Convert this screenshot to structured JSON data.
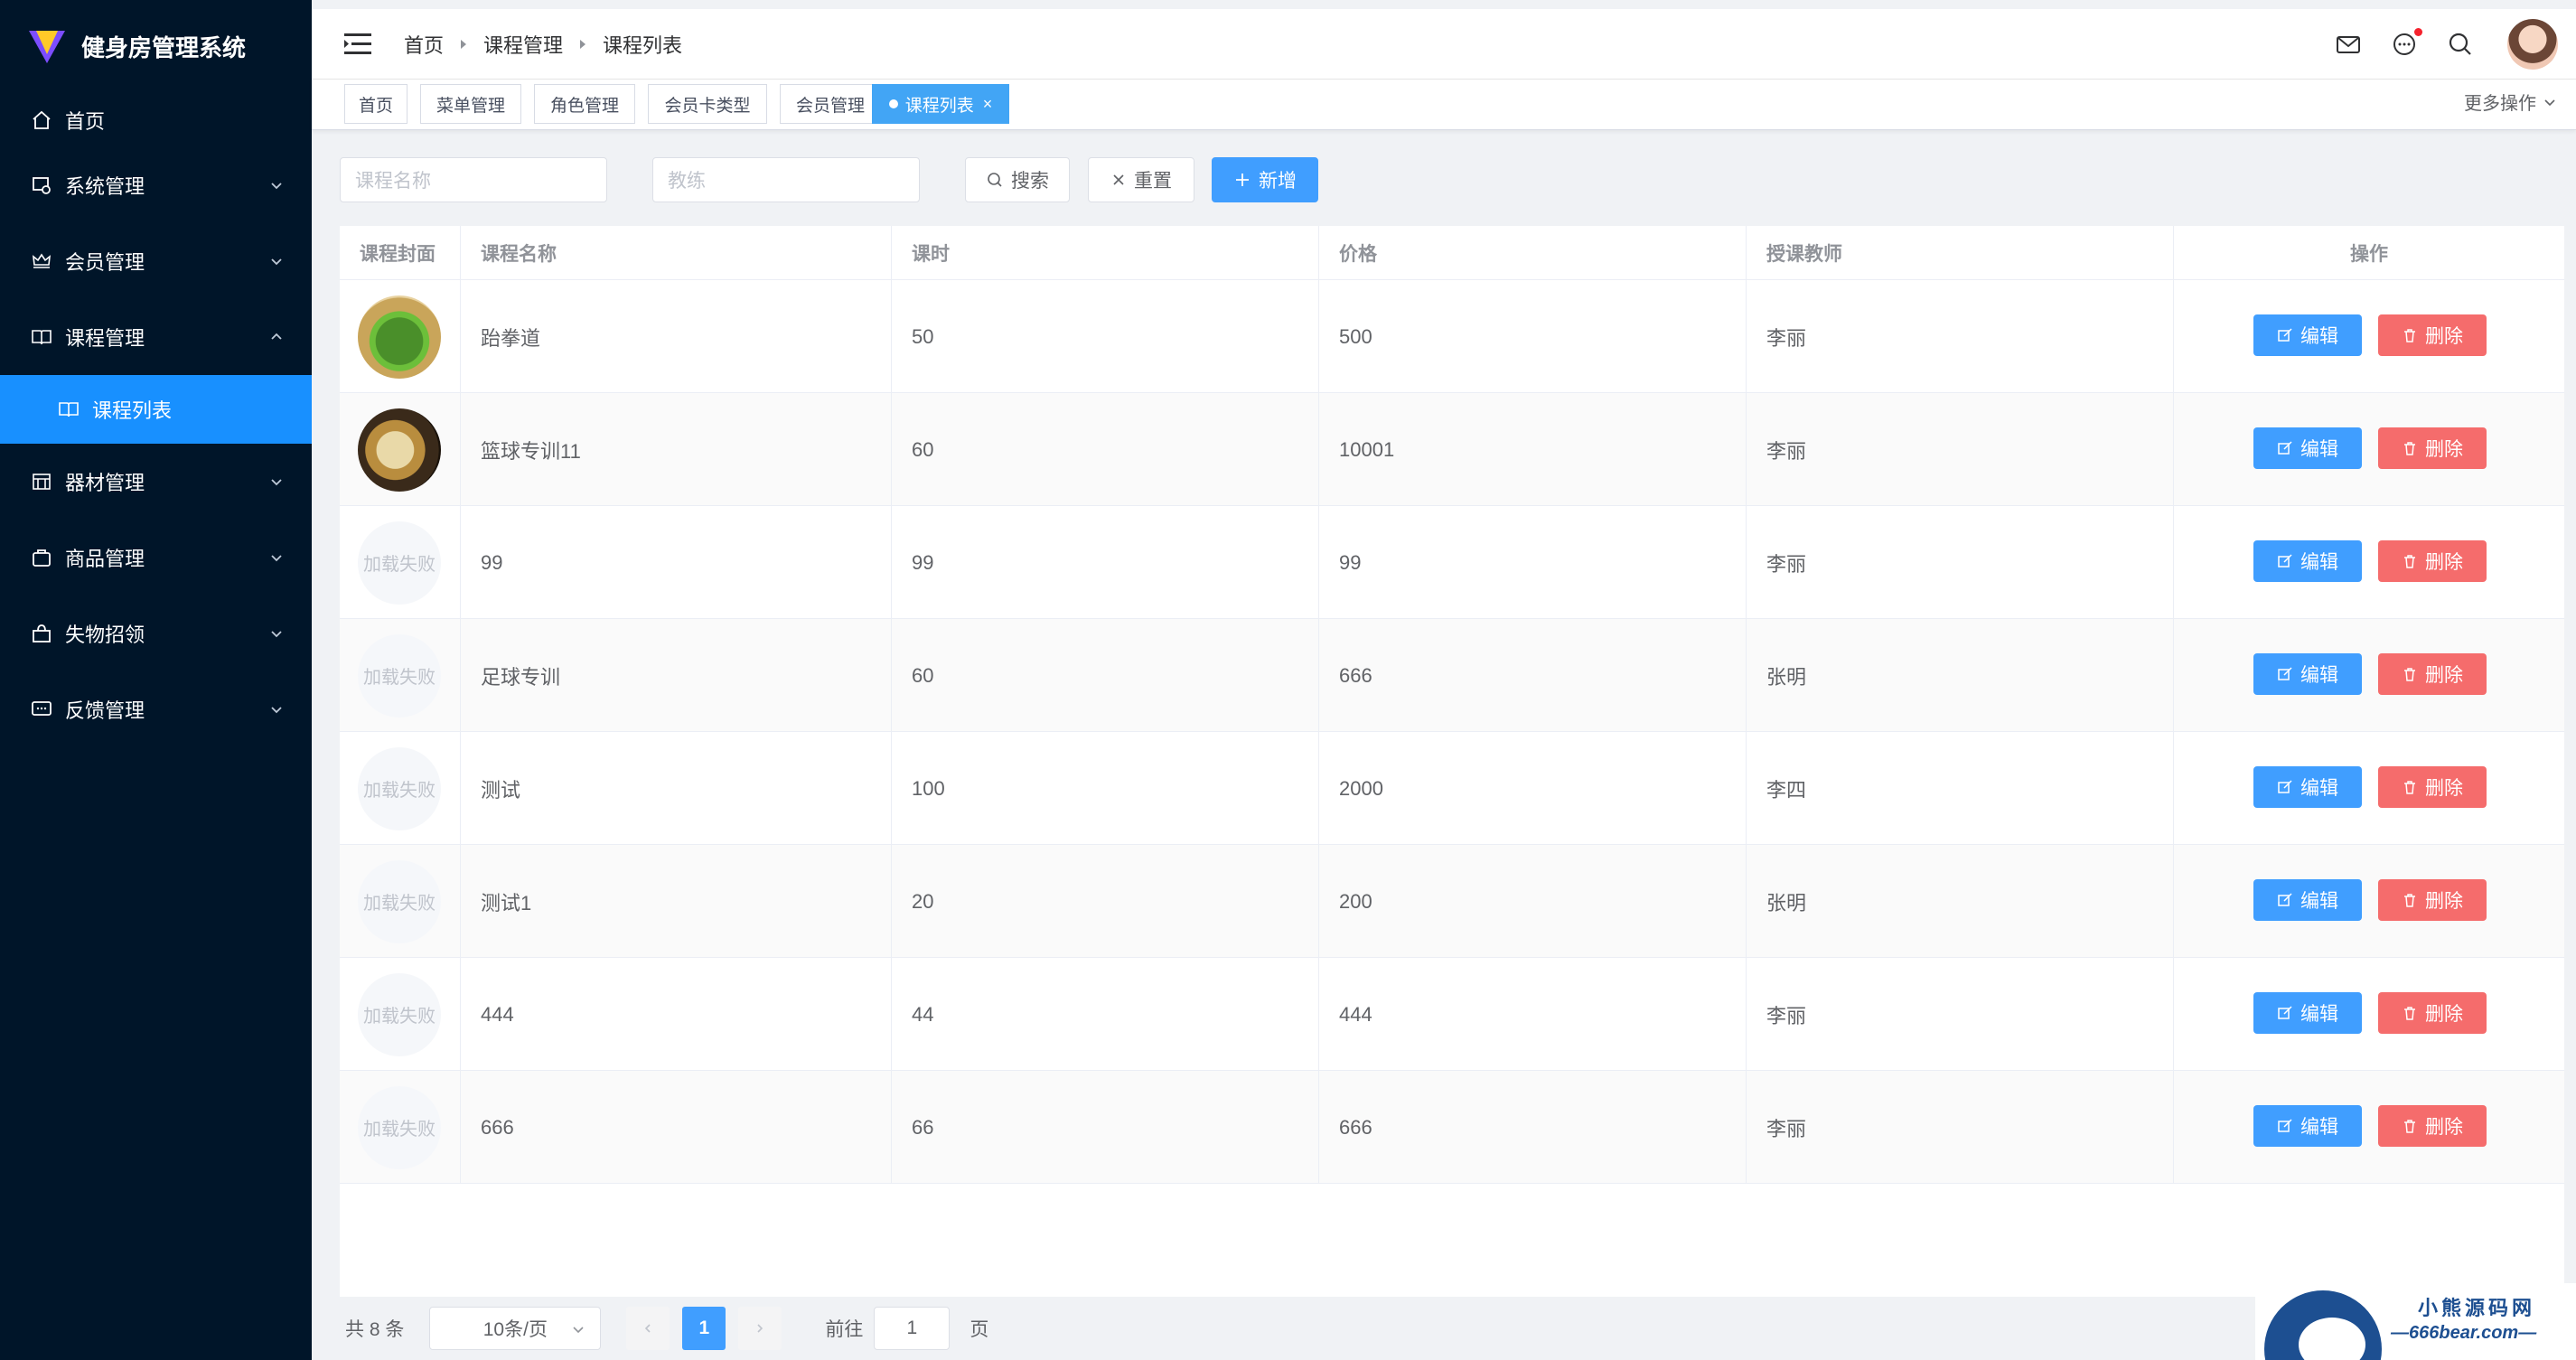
{
  "app": {
    "title": "健身房管理系统"
  },
  "sidebar": {
    "items": [
      {
        "label": "首页",
        "icon": "home-icon"
      },
      {
        "label": "系统管理",
        "icon": "system-icon"
      },
      {
        "label": "会员管理",
        "icon": "crown-icon"
      },
      {
        "label": "课程管理",
        "icon": "book-icon"
      },
      {
        "label": "课程列表",
        "icon": "reading-icon"
      },
      {
        "label": "器材管理",
        "icon": "equipment-icon"
      },
      {
        "label": "商品管理",
        "icon": "goods-icon"
      },
      {
        "label": "失物招领",
        "icon": "bag-icon"
      },
      {
        "label": "反馈管理",
        "icon": "chat-icon"
      }
    ]
  },
  "breadcrumb": [
    "首页",
    "课程管理",
    "课程列表"
  ],
  "tags": [
    "首页",
    "菜单管理",
    "角色管理",
    "会员卡类型",
    "会员管理",
    "课程列表"
  ],
  "more_ops": "更多操作",
  "filters": {
    "course_name_placeholder": "课程名称",
    "coach_placeholder": "教练",
    "search_label": "搜索",
    "reset_label": "重置",
    "add_label": "新增"
  },
  "table": {
    "columns": [
      "课程封面",
      "课程名称",
      "课时",
      "价格",
      "授课教师",
      "操作"
    ],
    "edit_label": "编辑",
    "delete_label": "删除",
    "load_failed": "加载失败",
    "rows": [
      {
        "name": "跆拳道",
        "hours": "50",
        "price": "500",
        "teacher": "李丽"
      },
      {
        "name": "篮球专训11",
        "hours": "60",
        "price": "10001",
        "teacher": "李丽"
      },
      {
        "name": "99",
        "hours": "99",
        "price": "99",
        "teacher": "李丽"
      },
      {
        "name": "足球专训",
        "hours": "60",
        "price": "666",
        "teacher": "张明"
      },
      {
        "name": "测试",
        "hours": "100",
        "price": "2000",
        "teacher": "李四"
      },
      {
        "name": "测试1",
        "hours": "20",
        "price": "200",
        "teacher": "张明"
      },
      {
        "name": "444",
        "hours": "44",
        "price": "444",
        "teacher": "李丽"
      },
      {
        "name": "666",
        "hours": "66",
        "price": "666",
        "teacher": "李丽"
      }
    ]
  },
  "pagination": {
    "total": "共 8 条",
    "page_size": "10条/页",
    "current": "1",
    "goto": "前往",
    "goto_value": "1",
    "unit": "页"
  },
  "watermark": {
    "line1": "小熊源码网",
    "line2": "—666bear.com—"
  },
  "colors": {
    "sidebar_bg": "#001529",
    "primary": "#409eff",
    "danger": "#f56c6c",
    "active_menu": "#1890ff"
  }
}
